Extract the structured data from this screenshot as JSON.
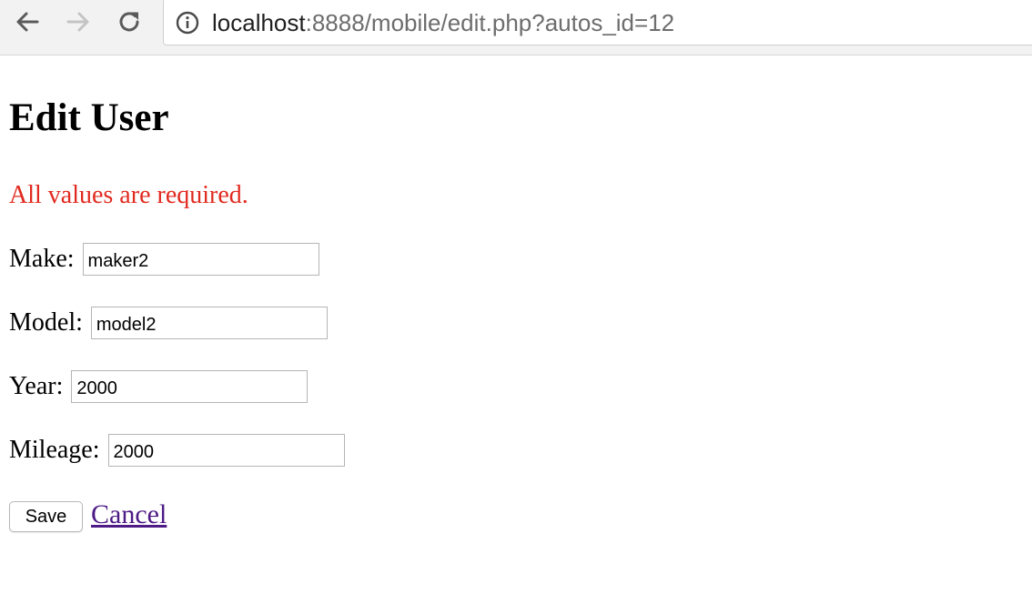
{
  "browser": {
    "url_host": "localhost",
    "url_rest": ":8888/mobile/edit.php?autos_id=12",
    "icons": {
      "back": "arrow-left-icon",
      "forward": "arrow-right-icon",
      "reload": "reload-icon",
      "site_info": "info-icon"
    }
  },
  "page": {
    "title": "Edit User",
    "error_message": "All values are required.",
    "form": {
      "make": {
        "label": "Make:",
        "value": "maker2"
      },
      "model": {
        "label": "Model:",
        "value": "model2"
      },
      "year": {
        "label": "Year:",
        "value": "2000"
      },
      "mileage": {
        "label": "Mileage:",
        "value": "2000"
      }
    },
    "save_label": "Save",
    "cancel_label": "Cancel"
  },
  "colors": {
    "error": "#e02a1f",
    "visited_link": "#4d1a86",
    "toolbar_bg": "#f2f2f2"
  }
}
